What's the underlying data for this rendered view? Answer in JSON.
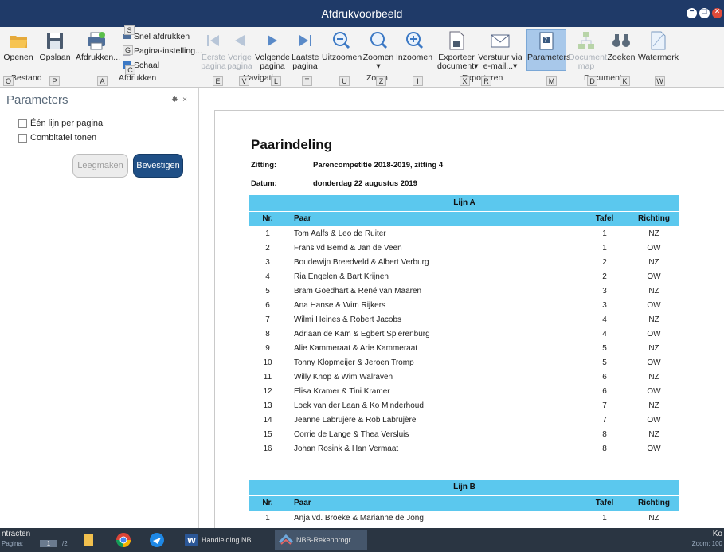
{
  "window": {
    "title": "Afdrukvoorbeeld"
  },
  "ribbon": {
    "bestand": {
      "open": "Openen",
      "save": "Opslaan",
      "group": "Bestand",
      "keys": [
        "O",
        "P"
      ]
    },
    "afdrukken": {
      "print": "Afdrukken...",
      "quick": "Snel afdrukken",
      "page_setup": "Pagina-instelling...",
      "scale": "Schaal",
      "group": "Afdrukken",
      "keys": [
        "A",
        "S",
        "G",
        "C"
      ]
    },
    "navigatie": {
      "first": "Eerste pagina",
      "first_1": "Eerste",
      "first_2": "pagina",
      "prev_1": "Vorige",
      "prev_2": "pagina",
      "next_1": "Volgende",
      "next_2": "pagina",
      "last_1": "Laatste",
      "last_2": "pagina",
      "group": "Navigatie",
      "keys": [
        "E",
        "V",
        "L",
        "T"
      ]
    },
    "zoom": {
      "out": "Uitzoomen",
      "zoom": "Zoomen",
      "in": "Inzoomen",
      "group": "Zoom",
      "keys": [
        "U",
        "Z",
        "I"
      ]
    },
    "exporteren": {
      "export_1": "Exporteer",
      "export_2": "document",
      "send_1": "Verstuur via",
      "send_2": "e-mail...",
      "group": "Exporteren",
      "keys": [
        "X",
        "R"
      ]
    },
    "document": {
      "params": "Parameters",
      "docmap_1": "Document",
      "docmap_2": "map",
      "search": "Zoeken",
      "watermark": "Watermerk",
      "group": "Document",
      "keys": [
        "M",
        "D",
        "K",
        "W"
      ]
    }
  },
  "panel": {
    "title": "Parameters",
    "pin": "✸",
    "close": "×",
    "options": [
      "Één lijn per pagina",
      "Combitafel tonen"
    ],
    "clear_btn": "Leegmaken",
    "confirm_btn": "Bevestigen"
  },
  "report": {
    "title": "Paarindeling",
    "zitting_label": "Zitting:",
    "zitting": "Parencompetitie 2018-2019, zitting 4",
    "datum_label": "Datum:",
    "datum": "donderdag 22 augustus 2019",
    "columns": {
      "nr": "Nr.",
      "paar": "Paar",
      "tafel": "Tafel",
      "richting": "Richting"
    },
    "lijn_a": {
      "title": "Lijn A",
      "rows": [
        {
          "nr": "1",
          "paar": "Tom Aalfs & Leo de Ruiter",
          "tafel": "1",
          "richting": "NZ"
        },
        {
          "nr": "2",
          "paar": "Frans vd Bemd & Jan de Veen",
          "tafel": "1",
          "richting": "OW"
        },
        {
          "nr": "3",
          "paar": "Boudewijn Breedveld & Albert Verburg",
          "tafel": "2",
          "richting": "NZ"
        },
        {
          "nr": "4",
          "paar": "Ria Engelen & Bart Krijnen",
          "tafel": "2",
          "richting": "OW"
        },
        {
          "nr": "5",
          "paar": "Bram Goedhart & René van Maaren",
          "tafel": "3",
          "richting": "NZ"
        },
        {
          "nr": "6",
          "paar": "Ana Hanse & Wim Rijkers",
          "tafel": "3",
          "richting": "OW"
        },
        {
          "nr": "7",
          "paar": "Wilmi Heines & Robert Jacobs",
          "tafel": "4",
          "richting": "NZ"
        },
        {
          "nr": "8",
          "paar": "Adriaan de Kam & Egbert Spierenburg",
          "tafel": "4",
          "richting": "OW"
        },
        {
          "nr": "9",
          "paar": "Alie Kammeraat & Arie Kammeraat",
          "tafel": "5",
          "richting": "NZ"
        },
        {
          "nr": "10",
          "paar": "Tonny Klopmeijer & Jeroen Tromp",
          "tafel": "5",
          "richting": "OW"
        },
        {
          "nr": "11",
          "paar": "Willy Knop & Wim Walraven",
          "tafel": "6",
          "richting": "NZ"
        },
        {
          "nr": "12",
          "paar": "Elisa Kramer & Tini Kramer",
          "tafel": "6",
          "richting": "OW"
        },
        {
          "nr": "13",
          "paar": "Loek van der Laan & Ko Minderhoud",
          "tafel": "7",
          "richting": "NZ"
        },
        {
          "nr": "14",
          "paar": "Jeanne Labrujère & Rob Labrujère",
          "tafel": "7",
          "richting": "OW"
        },
        {
          "nr": "15",
          "paar": "Corrie de Lange & Thea Versluis",
          "tafel": "8",
          "richting": "NZ"
        },
        {
          "nr": "16",
          "paar": "Johan Rosink & Han Vermaat",
          "tafel": "8",
          "richting": "OW"
        }
      ]
    },
    "lijn_b": {
      "title": "Lijn B",
      "rows": [
        {
          "nr": "1",
          "paar": "Anja vd. Broeke & Marianne de  Jong",
          "tafel": "1",
          "richting": "NZ"
        }
      ]
    }
  },
  "taskbar": {
    "left_text": "ntracten",
    "page_label": "Pagina:",
    "page_value": "1",
    "page_of": "/2",
    "apps": [
      "Handleiding NB...",
      "NBB-Rekenprogr..."
    ],
    "right_text": "Ko",
    "zoom_text": "Zoom: 100"
  },
  "colors": {
    "titlebar": "#1f3a68",
    "table_header": "#5bc8ee",
    "confirm": "#1f4f86"
  }
}
